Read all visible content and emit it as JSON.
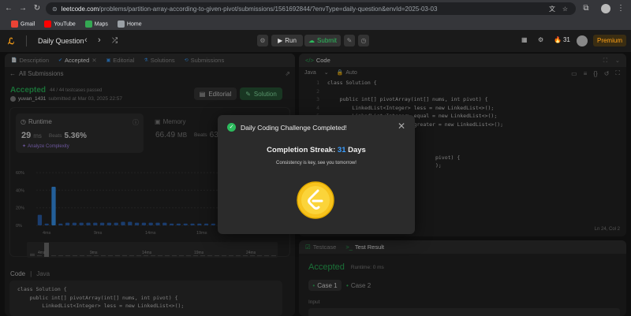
{
  "browser": {
    "url_host": "leetcode.com",
    "url_path": "/problems/partition-array-according-to-given-pivot/submissions/1561692844/?envType=daily-question&envId=2025-03-03",
    "bookmarks": [
      {
        "label": "Gmail",
        "color": "#ea4335"
      },
      {
        "label": "YouTube",
        "color": "#ff0000"
      },
      {
        "label": "Maps",
        "color": "#34a853"
      },
      {
        "label": "Home",
        "color": "#9aa0a6"
      }
    ]
  },
  "header": {
    "daily_label": "Daily Question",
    "run_label": "Run",
    "submit_label": "Submit",
    "streak_count": "31",
    "premium_label": "Premium"
  },
  "left": {
    "tabs": [
      "Description",
      "Accepted",
      "Editorial",
      "Solutions",
      "Submissions"
    ],
    "all_submissions": "All Submissions",
    "status": "Accepted",
    "passed": "44 / 44 testcases passed",
    "user": "yuvan_1431",
    "submitted": "submitted at Mar 03, 2025 22:57",
    "editorial_btn": "Editorial",
    "solution_btn": "Solution",
    "runtime_label": "Runtime",
    "runtime_value": "29",
    "runtime_unit": "ms",
    "beats_label": "Beats",
    "runtime_beats": "5.36%",
    "analyze_label": "Analyze Complexity",
    "memory_label": "Memory",
    "memory_value": "66.49",
    "memory_unit": "MB",
    "memory_beats": "63.7",
    "code_label": "Code",
    "lang_label": "Java",
    "code_lines": [
      "class Solution {",
      "",
      "    public int[] pivotArray(int[] nums, int pivot) {",
      "        LinkedList<Integer> less = new LinkedList<>();"
    ]
  },
  "chart_data": {
    "type": "bar",
    "ylabels": [
      "60%",
      "40%",
      "20%",
      "0%"
    ],
    "xlabels": [
      "4ms",
      "9ms",
      "14ms",
      "19ms"
    ],
    "values": [
      12,
      2,
      44,
      2,
      3,
      3,
      3,
      3,
      3,
      3,
      3,
      3,
      4,
      4,
      3,
      3,
      3,
      3,
      3,
      2,
      2,
      2,
      2,
      2,
      2,
      2,
      2,
      2,
      2,
      2,
      2,
      2,
      2,
      2,
      2
    ],
    "highlight_index": 2,
    "ylim": [
      0,
      70
    ],
    "mini_xlabels": [
      "4ms",
      "9ms",
      "14ms",
      "19ms",
      "24ms"
    ]
  },
  "right": {
    "code_title": "Code",
    "lang": "Java",
    "auto_label": "Auto",
    "code_lines": [
      {
        "n": "1",
        "t": "class Solution {"
      },
      {
        "n": "2",
        "t": ""
      },
      {
        "n": "3",
        "t": "    public int[] pivotArray(int[] nums, int pivot) {"
      },
      {
        "n": "4",
        "t": "        LinkedList<Integer> less = new LinkedList<>();"
      },
      {
        "n": "5",
        "t": "        LinkedList<Integer> equal = new LinkedList<>();"
      },
      {
        "n": "6",
        "t": "        LinkedList<Integer> greater = new LinkedList<>();"
      },
      {
        "n": "7",
        "t": ""
      },
      {
        "n": "8",
        "t": ""
      },
      {
        "n": "9",
        "t": ""
      },
      {
        "n": "10",
        "t": "                                   pivot) {"
      },
      {
        "n": "11",
        "t": "                                   );"
      }
    ],
    "cursor_pos": "Ln 24, Col 2",
    "testcase_label": "Testcase",
    "result_label": "Test Result",
    "accepted": "Accepted",
    "runtime": "Runtime: 0 ms",
    "case1": "Case 1",
    "case2": "Case 2",
    "input_label": "Input"
  },
  "modal": {
    "title": "Daily Coding Challenge Completed!",
    "streak_prefix": "Completion Streak:",
    "streak_num": "31",
    "streak_suffix": "Days",
    "subtitle": "Consistency is key, see you tomorrow!"
  }
}
